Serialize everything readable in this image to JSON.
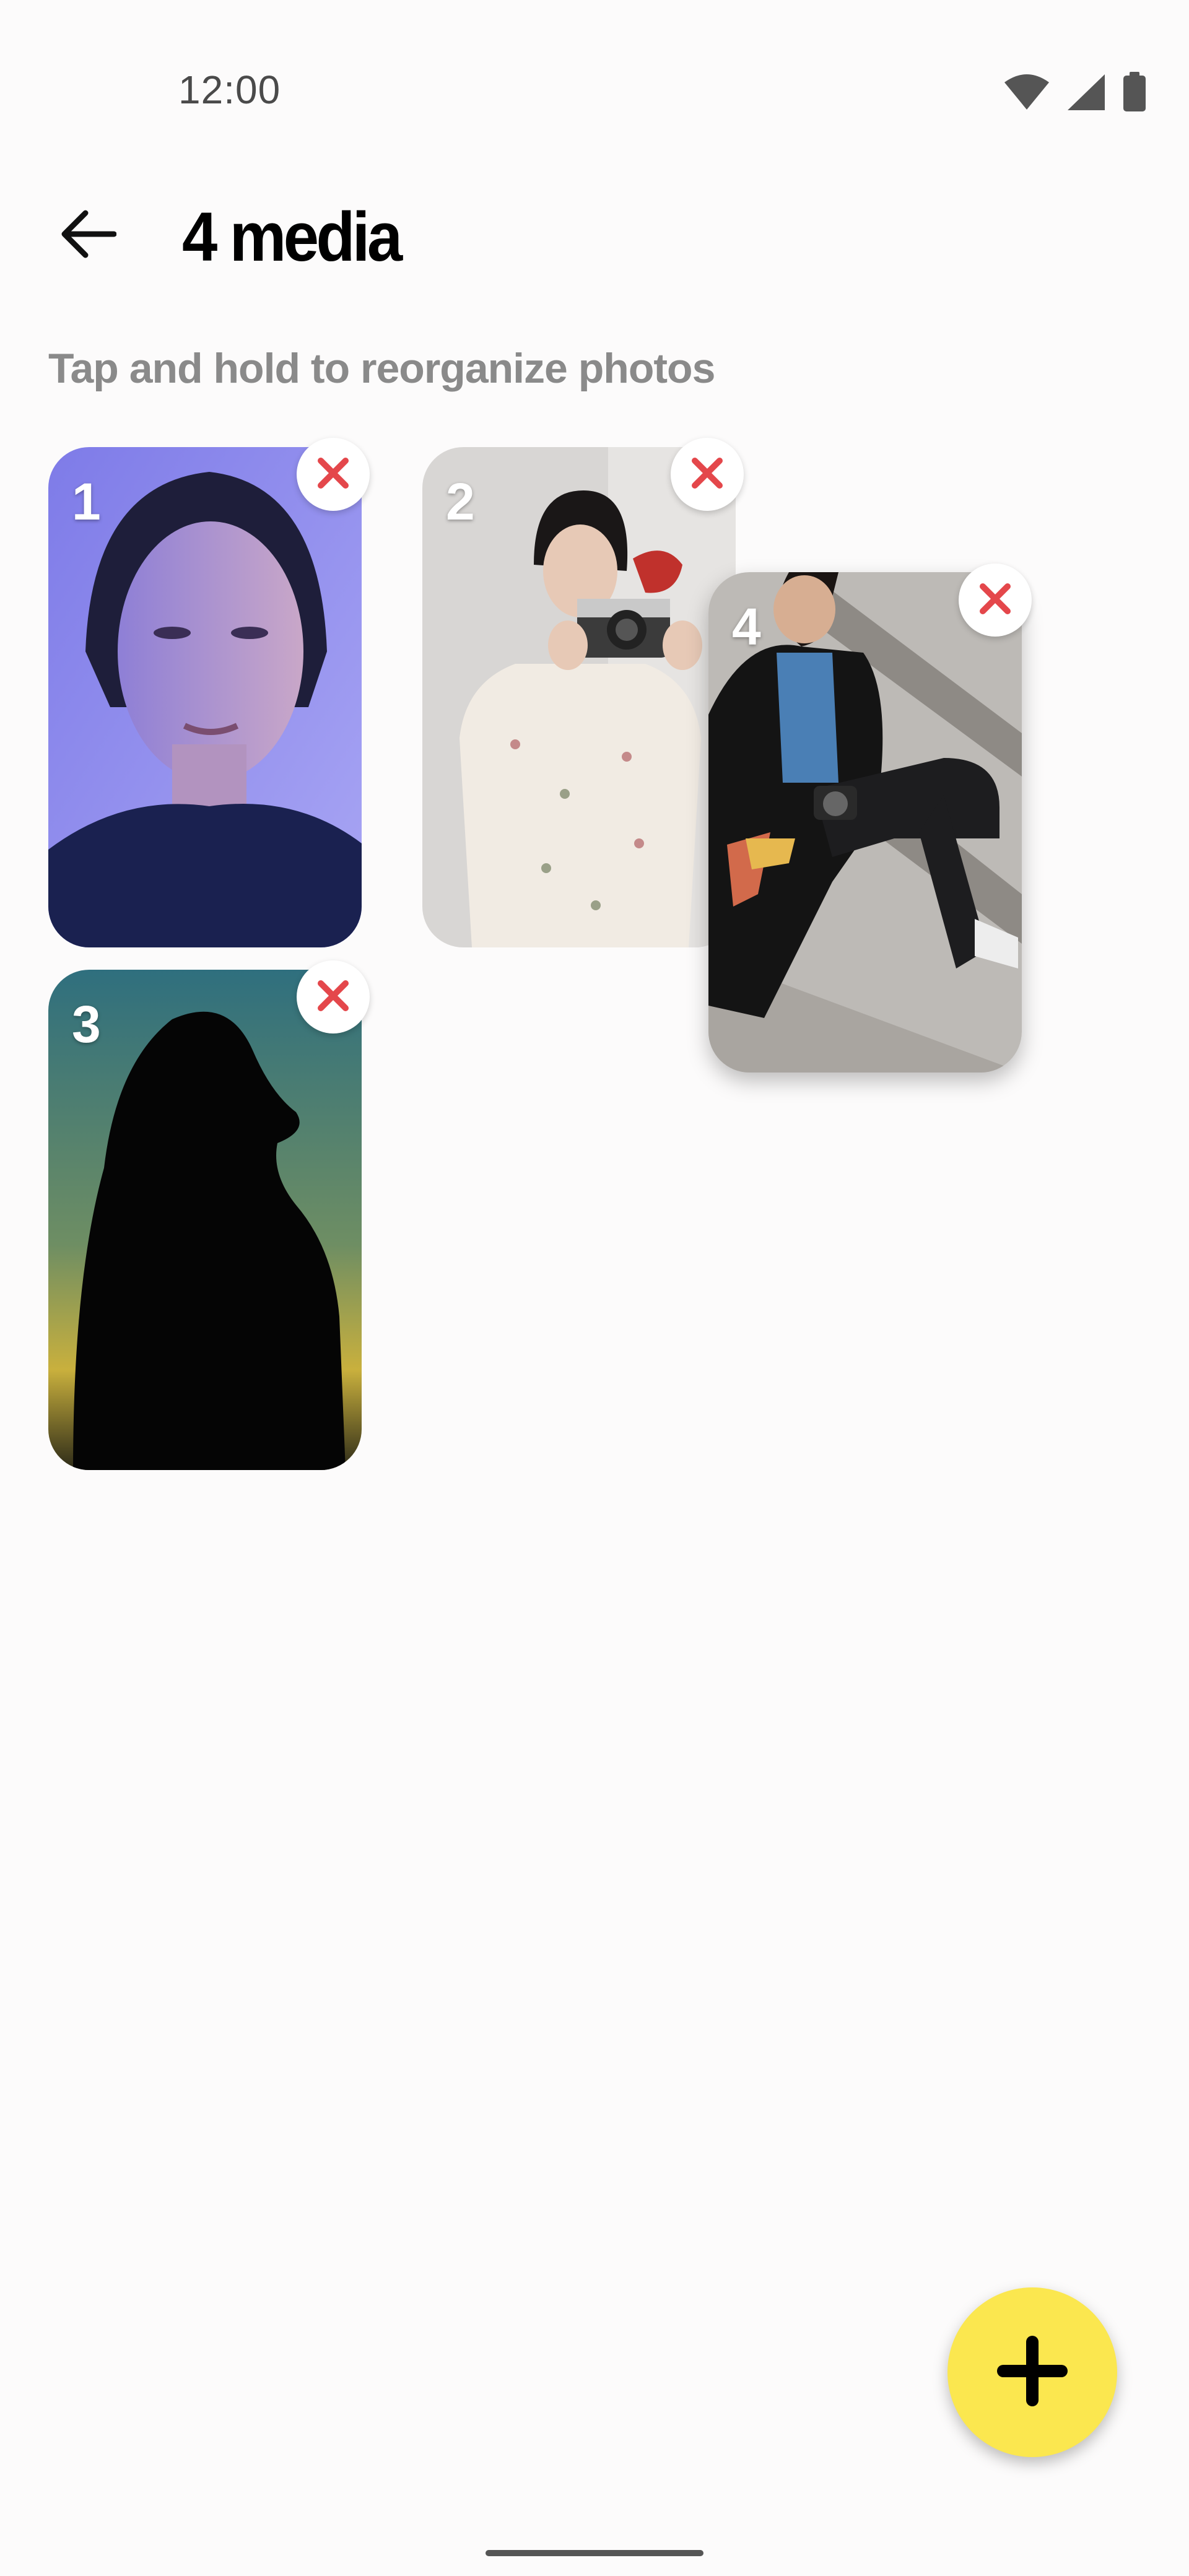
{
  "status_bar": {
    "time": "12:00",
    "icons": [
      "wifi-icon",
      "signal-icon",
      "battery-icon"
    ]
  },
  "header": {
    "back_icon": "arrow-left-icon",
    "title": "4 media"
  },
  "hint": "Tap and hold to reorganize photos",
  "media": [
    {
      "number": "1",
      "description_icon": "photo-woman-portrait-blue"
    },
    {
      "number": "2",
      "description_icon": "photo-woman-camera-dress"
    },
    {
      "number": "3",
      "description_icon": "photo-silhouette-sunset"
    },
    {
      "number": "4",
      "description_icon": "photo-woman-camera-stairs"
    }
  ],
  "remove_icon": "close-icon",
  "fab_icon": "plus-icon",
  "colors": {
    "accent_yellow": "#FBE74F",
    "remove_red": "#E4474B",
    "hint_gray": "#8A8A8A",
    "background": "#FCFBFB"
  }
}
